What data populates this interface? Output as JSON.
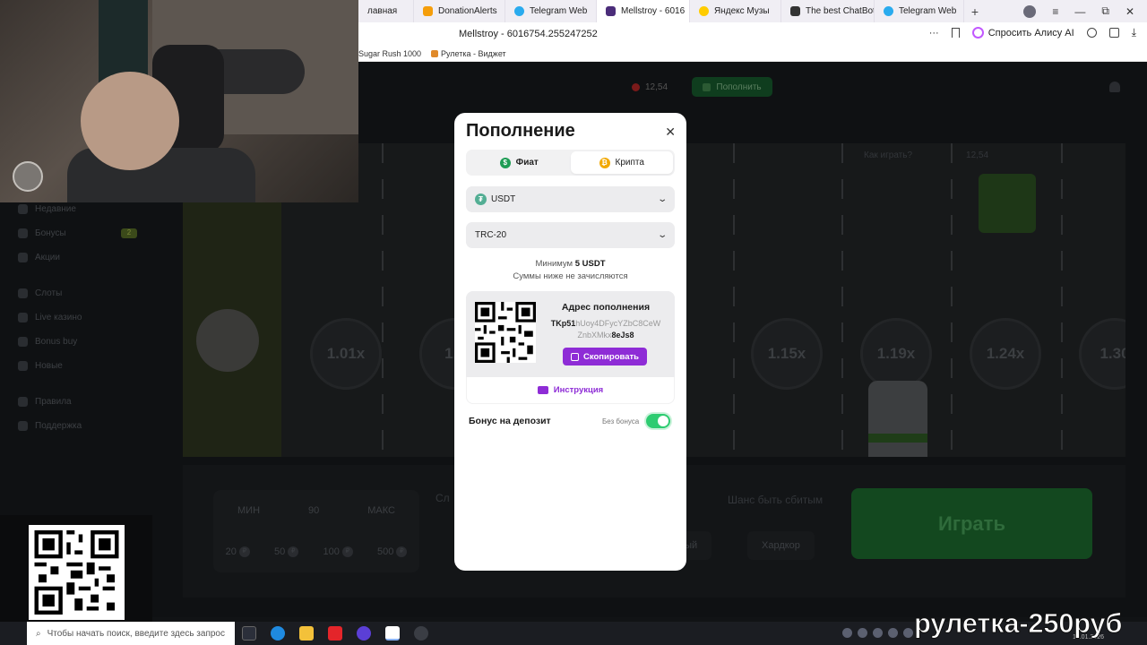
{
  "browser": {
    "tabs": [
      {
        "label": "лавная",
        "color": "#8b5cf6",
        "active": false
      },
      {
        "label": "DonationAlerts",
        "color": "#f59e0b",
        "active": false
      },
      {
        "label": "Telegram Web",
        "color": "#2aabee",
        "active": false
      },
      {
        "label": "Mellstroy - 6016",
        "color": "#4b2d7a",
        "active": true
      },
      {
        "label": "Яндекс Музы",
        "color": "#ffcc00",
        "active": false
      },
      {
        "label": "The best ChatBot",
        "color": "#333333",
        "active": false
      },
      {
        "label": "Telegram Web",
        "color": "#2aabee",
        "active": false
      }
    ],
    "new_tab": "+",
    "close_tab": "✕",
    "window_controls": {
      "menu": "≡",
      "minimize": "—",
      "restore": "⧉",
      "close": "✕"
    },
    "url": "Mellstroy - 6016754.255247252",
    "menu_dots": "···",
    "ask_alice": "Спросить Алису AI",
    "bookmarks": [
      "Sugar Rush 1000",
      "Рулетка - Виджет"
    ]
  },
  "site": {
    "balance": "12,54",
    "deposit": "Пополнить",
    "sidebar": [
      {
        "label": "Недавние",
        "badge": ""
      },
      {
        "label": "Бонусы",
        "badge": "2"
      },
      {
        "label": "Акции",
        "badge": ""
      },
      {
        "label": "Слоты",
        "badge": ""
      },
      {
        "label": "Live казино",
        "badge": ""
      },
      {
        "label": "Bonus buy",
        "badge": ""
      },
      {
        "label": "Новые",
        "badge": ""
      },
      {
        "label": "Правила",
        "badge": ""
      },
      {
        "label": "Поддержка",
        "badge": ""
      }
    ],
    "game": {
      "how_to_play": "Как играть?",
      "balance": "12,54",
      "coefficients": [
        "1.01x",
        "1.0",
        "1.15x",
        "1.19x",
        "1.24x",
        "1.30"
      ],
      "min_label": "МИН",
      "bet_value": "90",
      "max_label": "МАКС",
      "chips": [
        "20",
        "50",
        "100",
        "500"
      ],
      "currency": "₽",
      "middle_label": "Сл",
      "chance_label": "Шанс быть сбитым",
      "difficulty_buttons": [
        "ный",
        "Хардкор"
      ],
      "play_button": "Играть"
    }
  },
  "modal": {
    "title": "Пополнение",
    "close": "✕",
    "tabs": [
      {
        "label": "Фиат",
        "icon": "$",
        "color": "#1f9d55"
      },
      {
        "label": "Крипта",
        "icon": "₿",
        "color": "#f2a900"
      }
    ],
    "currency_select": {
      "value": "USDT",
      "icon": "₮"
    },
    "network_select": {
      "value": "TRC-20"
    },
    "chevron": "⌄",
    "minimum_prefix": "Минимум ",
    "minimum_value": "5 USDT",
    "minimum_note": "Суммы ниже не зачисляются",
    "address_title": "Адрес пополнения",
    "address_start": "TKp51",
    "address_mid1": "hUoy4DFycYZbC8CeW",
    "address_mid2": "ZnbXMkx",
    "address_end": "8eJs8",
    "copy_button": "Скопировать",
    "instruction": "Инструкция",
    "bonus_label": "Бонус на депозит",
    "bonus_state": "Без бонуса",
    "bonus_enabled": true
  },
  "taskbar": {
    "search_placeholder": "Чтобы начать поиск, введите здесь запрос",
    "search_icon": "⌕",
    "clock": "19.01.2026"
  },
  "promo": "рулетка-250руб",
  "colors": {
    "accent_purple": "#8e2cd6",
    "toggle_green": "#2ecc71",
    "play_green": "#13481f",
    "tether": "#53ae94"
  }
}
